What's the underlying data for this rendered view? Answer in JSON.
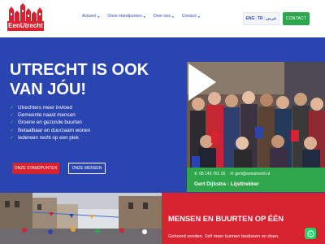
{
  "brand": {
    "name": "EenUtrecht",
    "accent_red": "#d7232f",
    "accent_green": "#2ea64c",
    "hero_blue": "#2b45b0"
  },
  "nav": {
    "items": [
      {
        "label": "Actueel",
        "icon": "chevron-down-icon"
      },
      {
        "label": "Onze standpunten",
        "icon": "chevron-down-icon"
      },
      {
        "label": "Over ons",
        "icon": "chevron-down-icon"
      },
      {
        "label": "Contact",
        "icon": "chevron-down-icon"
      }
    ]
  },
  "languages": [
    "ENG",
    "TR",
    "عربي"
  ],
  "contact_button": "CONTACT",
  "hero": {
    "title_line1": "UTRECHT IS OOK",
    "title_line2": "VAN JÓU!",
    "bullets": [
      "Utrechters meer invloed",
      "Gemeente naast mensen",
      "Groene en gezonde buurten",
      "Betaalbaar en duurzaam wonen",
      "Iedereen recht op een plek"
    ],
    "primary_button": "ONZE STANDPUNTEN",
    "secondary_button": "ONZE MENSEN"
  },
  "video": {
    "phone": "06 143 761 16",
    "email": "gert@eenutrecht.nl",
    "name": "Gert Dijkstra - Lijsttrekker"
  },
  "section": {
    "title": "MENSEN EN BUURTEN OP ÉÉN",
    "subtitle": "Gehoord worden. Zelf meer kunnen beslissen en doen."
  }
}
